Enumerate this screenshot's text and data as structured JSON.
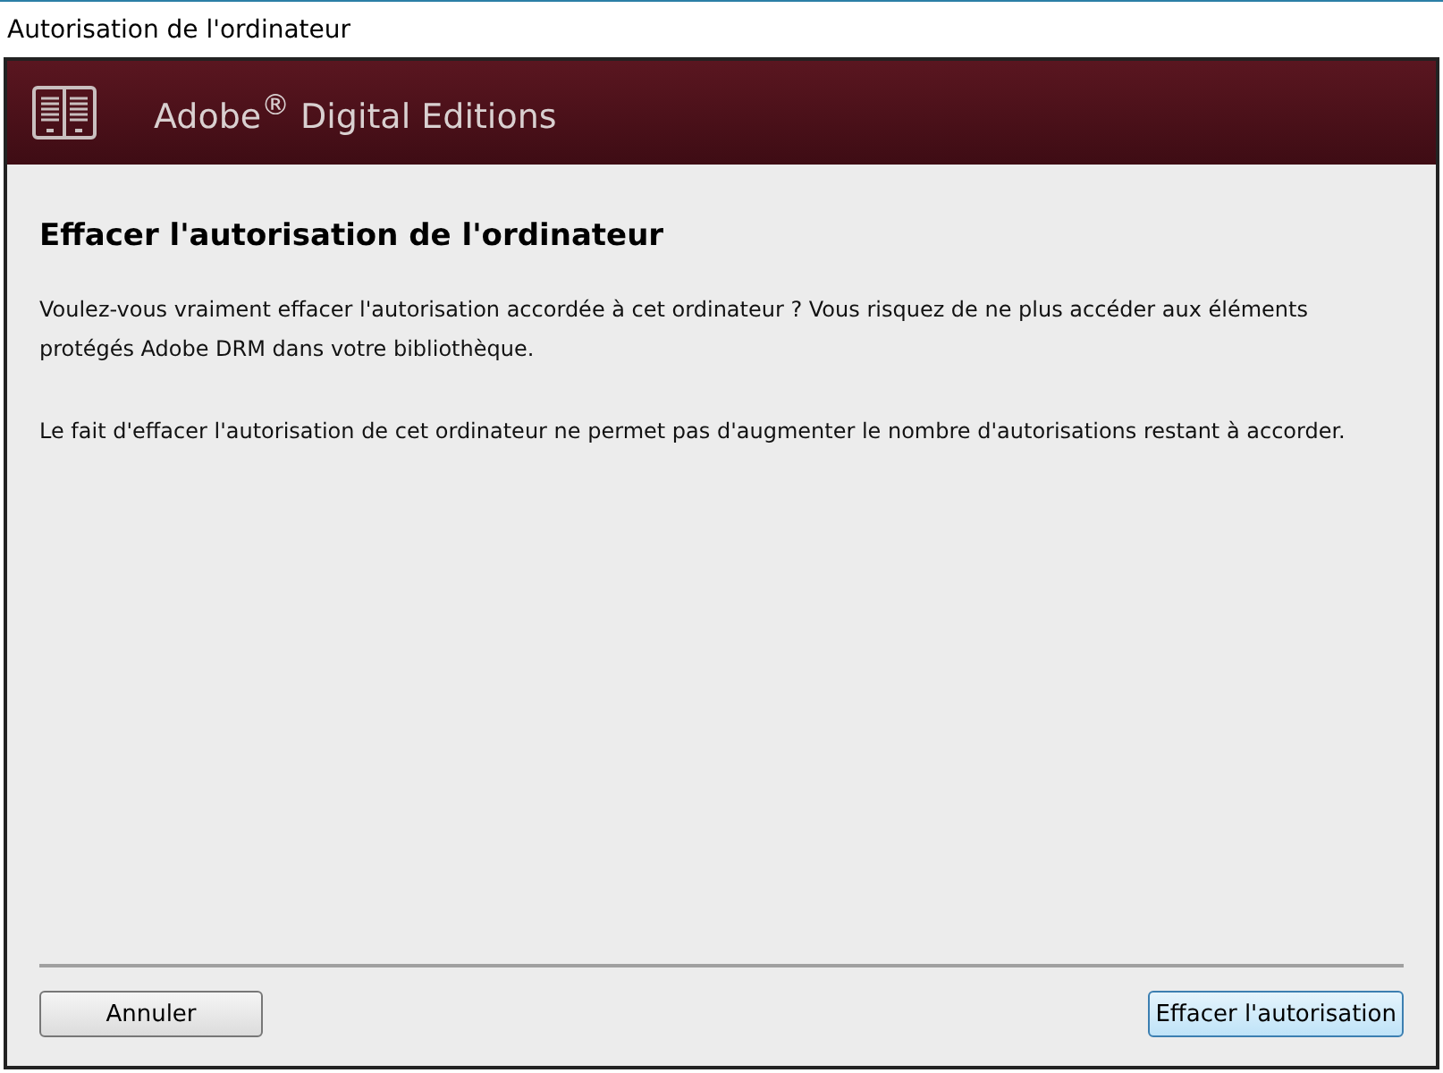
{
  "window": {
    "title": "Autorisation de l'ordinateur"
  },
  "header": {
    "product": "Adobe$^{®}$ Digital Editions"
  },
  "heading": "Effacer l'autorisation de l'ordinateur",
  "paragraphs": [
    "Voulez-vous vraiment effacer l'autorisation accordée à cet ordinateur ? Vous risquez de ne plus accéder aux éléments protégés Adobe DRM dans votre bibliothèque.",
    "Le fait d'effacer l'autorisation de cet ordinateur ne permet pas d'augmenter le nombre d'autorisations restant à accorder."
  ],
  "buttons": [
    {
      "label": "Annuler",
      "default": false
    },
    {
      "label": "Effacer l'autorisation",
      "default": true
    }
  ]
}
